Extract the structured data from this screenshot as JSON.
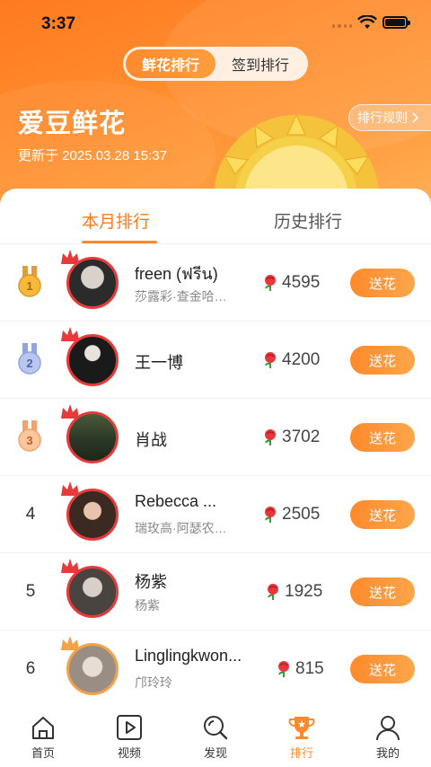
{
  "status": {
    "time": "3:37"
  },
  "segment": {
    "items": [
      "鲜花排行",
      "签到排行"
    ],
    "active": 0
  },
  "header": {
    "title": "爱豆鲜花",
    "updated": "更新于 2025.03.28 15:37",
    "rules_label": "排行规则"
  },
  "tabs": {
    "items": [
      "本月排行",
      "历史排行"
    ],
    "active": 0
  },
  "ranking": [
    {
      "rank": "1",
      "name": "freen (ฟรีน)",
      "sub": "莎露彩·查金哈…",
      "flowers": "4595",
      "action": "送花"
    },
    {
      "rank": "2",
      "name": "王一博",
      "sub": "",
      "flowers": "4200",
      "action": "送花"
    },
    {
      "rank": "3",
      "name": "肖战",
      "sub": "",
      "flowers": "3702",
      "action": "送花"
    },
    {
      "rank": "4",
      "name": "Rebecca ...",
      "sub": "瑞玫高·阿瑟农…",
      "flowers": "2505",
      "action": "送花"
    },
    {
      "rank": "5",
      "name": "杨紫",
      "sub": "杨紫",
      "flowers": "1925",
      "action": "送花"
    },
    {
      "rank": "6",
      "name": "Linglingkwon...",
      "sub": "邝玲玲",
      "flowers": "815",
      "action": "送花"
    }
  ],
  "nav": [
    {
      "label": "首页",
      "icon": "home-icon"
    },
    {
      "label": "视频",
      "icon": "video-icon"
    },
    {
      "label": "发现",
      "icon": "discover-icon"
    },
    {
      "label": "排行",
      "icon": "trophy-icon"
    },
    {
      "label": "我的",
      "icon": "profile-icon"
    }
  ],
  "colors": {
    "accent": "#ff8a2c",
    "crown_red": "#e83a3a"
  }
}
